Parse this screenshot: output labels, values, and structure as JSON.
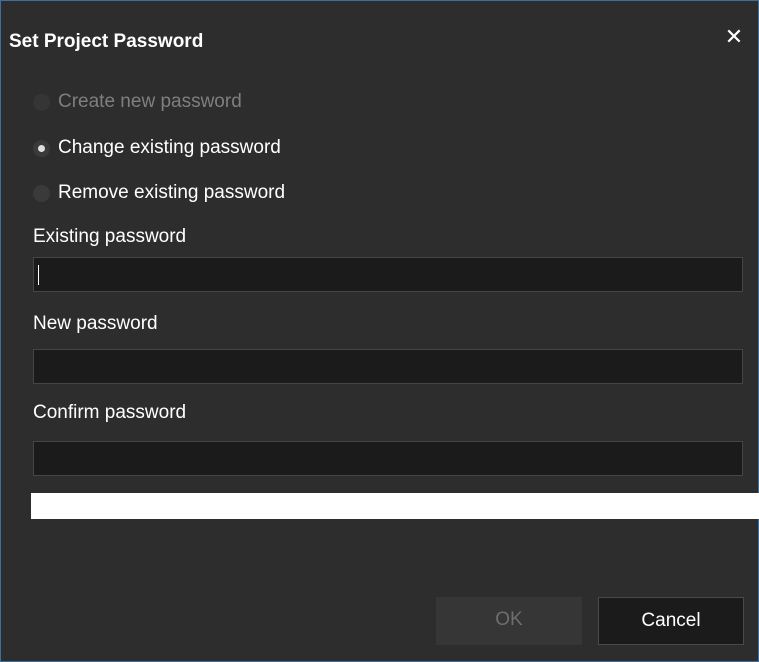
{
  "dialog": {
    "title": "Set Project Password",
    "close_glyph": "✕"
  },
  "options": [
    {
      "label": "Create new password",
      "checked": false,
      "enabled": false
    },
    {
      "label": "Change existing password",
      "checked": true,
      "enabled": true
    },
    {
      "label": "Remove existing password",
      "checked": false,
      "enabled": true
    }
  ],
  "fields": {
    "existing_label": "Existing password",
    "existing_value": "",
    "new_label": "New password",
    "new_value": "",
    "confirm_label": "Confirm password",
    "confirm_value": ""
  },
  "buttons": {
    "ok_label": "OK",
    "ok_enabled": false,
    "cancel_label": "Cancel"
  },
  "colors": {
    "background": "#2d2d2d",
    "input_background": "#1b1b1b",
    "border_accent": "#3d6f9e"
  }
}
